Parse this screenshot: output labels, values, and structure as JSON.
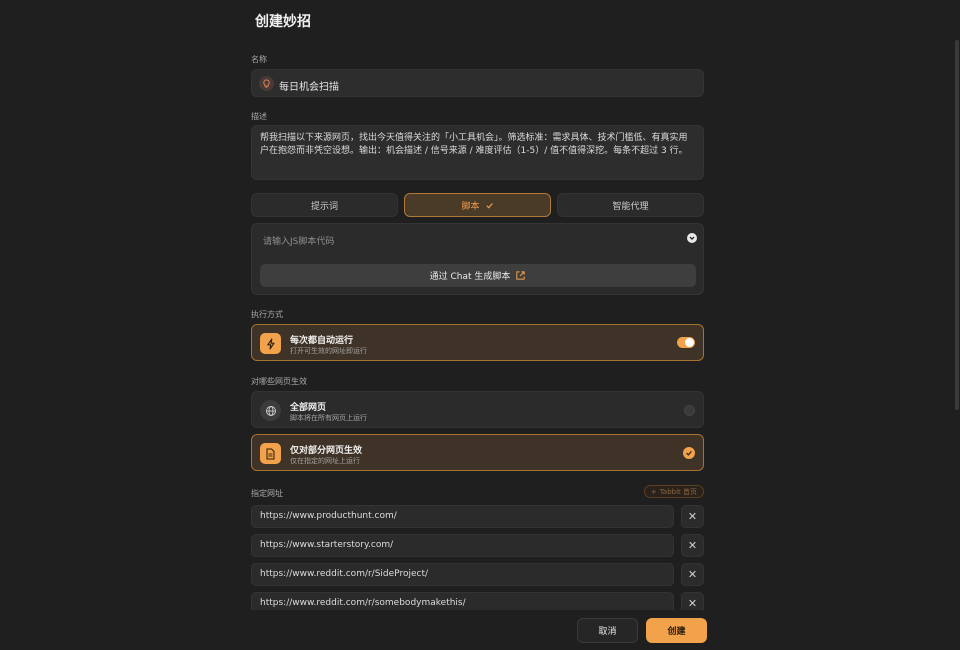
{
  "dialog": {
    "title": "创建妙招"
  },
  "name_field": {
    "label": "名称",
    "value": "每日机会扫描"
  },
  "description_field": {
    "label": "描述",
    "value": "帮我扫描以下来源网页，找出今天值得关注的「小工具机会」。筛选标准：需求具体、技术门槛低、有真实用户在抱怨而非凭空设想。输出：机会描述 / 信号来源 / 难度评估（1-5）/ 值不值得深挖。每条不超过 3 行。"
  },
  "type_tabs": [
    {
      "label": "提示词",
      "active": false
    },
    {
      "label": "脚本",
      "active": true
    },
    {
      "label": "智能代理",
      "active": false
    }
  ],
  "script": {
    "placeholder": "请输入JS脚本代码",
    "generate_button": "通过 Chat 生成脚本"
  },
  "execution": {
    "label": "执行方式",
    "option": {
      "title": "每次都自动运行",
      "subtitle": "打开可生效的网址即运行",
      "enabled": true
    }
  },
  "scope": {
    "label": "对哪些网页生效",
    "options": [
      {
        "title": "全部网页",
        "subtitle": "脚本将在所有网页上运行",
        "selected": false
      },
      {
        "title": "仅对部分网页生效",
        "subtitle": "仅在指定的网址上运行",
        "selected": true
      }
    ]
  },
  "urls": {
    "label": "指定网址",
    "add_button": "Tabbit 首页",
    "items": [
      "https://www.producthunt.com/",
      "https://www.starterstory.com/",
      "https://www.reddit.com/r/SideProject/",
      "https://www.reddit.com/r/somebodymakethis/"
    ]
  },
  "footer": {
    "cancel": "取消",
    "create": "创建"
  },
  "colors": {
    "accent": "#f1a24a",
    "background": "#1f1f1f",
    "surface": "#2b2b2b"
  }
}
